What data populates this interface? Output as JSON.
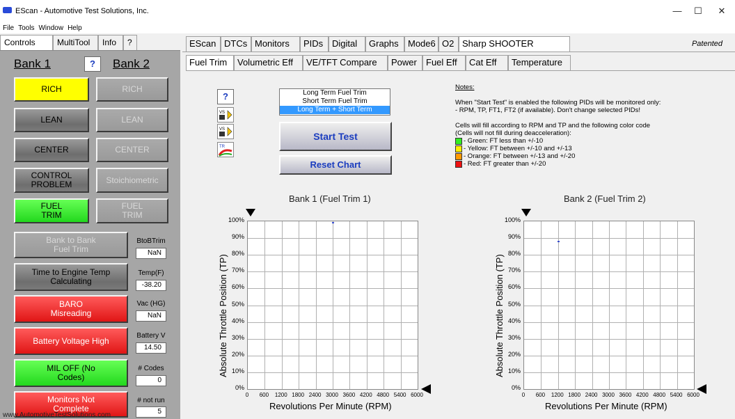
{
  "window": {
    "title": "EScan - Automotive Test Solutions, Inc.",
    "minimize": "—",
    "maximize": "☐",
    "close": "✕"
  },
  "menu": [
    "File",
    "Tools",
    "Window",
    "Help"
  ],
  "left_tabs": [
    "Controls",
    "MultiTool",
    "Info",
    "?"
  ],
  "left": {
    "bank1": "Bank 1",
    "q": "?",
    "bank2": "Bank 2",
    "rich1": "RICH",
    "rich2": "RICH",
    "lean1": "LEAN",
    "lean2": "LEAN",
    "center1": "CENTER",
    "center2": "CENTER",
    "control_problem": "CONTROL PROBLEM",
    "stoich": "Stoichiometric",
    "fuel_trim1": "FUEL TRIM",
    "fuel_trim2": "FUEL TRIM",
    "btb_btn": "Bank to Bank Fuel Trim",
    "btb_label": "BtoBTrim",
    "btb_value": "NaN",
    "temp_btn": "Time to Engine Temp Calculating",
    "temp_label": "Temp(F)",
    "temp_value": "-38.20",
    "baro_btn": "BARO Misreading",
    "vac_label": "Vac (HG)",
    "vac_value": "NaN",
    "batt_btn": "Battery Voltage High",
    "batt_label": "Battery V",
    "batt_value": "14.50",
    "mil_btn": "MIL OFF (No Codes)",
    "codes_label": "# Codes",
    "codes_value": "0",
    "monitors_btn": "Monitors Not Complete",
    "notrun_label": "# not run",
    "notrun_value": "5",
    "website": "www.AutomotiveTestSolutions.com"
  },
  "right_tabs": [
    "EScan",
    "DTCs",
    "Monitors",
    "PIDs",
    "Digital",
    "Graphs",
    "Mode6",
    "O2",
    "Sharp SHOOTER"
  ],
  "patented": "Patented",
  "sub_tabs": [
    "Fuel Trim",
    "Volumetric Eff",
    "VE/TFT Compare",
    "Power",
    "Fuel Eff",
    "Cat Eff",
    "Temperature"
  ],
  "content": {
    "help_q": "?",
    "icon_vs1": "VS",
    "icon_vs2": "VS",
    "icon_tr": "TR",
    "mode_options": [
      "Long Term Fuel Trim",
      "Short Term Fuel Trim",
      "Long Term + Short Term"
    ],
    "mode_selected": 2,
    "start_test": "Start Test",
    "reset_chart": "Reset Chart",
    "notes_title": "Notes:",
    "notes_line1": "When \"Start Test\" is enabled the following PIDs will be monitored only:",
    "notes_line2": "- RPM, TP, FT1, FT2 (if available).  Don't change selected PIDs!",
    "notes_line3": "Cells will fill according to RPM and TP and the following color code",
    "notes_line4": "(Cells will not fill during deacceleration):",
    "legend": [
      {
        "color": "#33ee22",
        "text": "- Green:  FT less than +/-10"
      },
      {
        "color": "#ffee00",
        "text": "- Yellow:  FT between +/-10 and +/-13"
      },
      {
        "color": "#ff9900",
        "text": "- Orange: FT between +/-13 and +/-20"
      },
      {
        "color": "#ee1111",
        "text": "- Red:     FT greater than +/-20"
      }
    ]
  },
  "chart_data": [
    {
      "type": "scatter",
      "title": "Bank 1 (Fuel Trim 1)",
      "xlabel": "Revolutions Per Minute (RPM)",
      "ylabel": "Absolute Throttle Position (TP)",
      "xlim": [
        0,
        6000
      ],
      "ylim": [
        0,
        100
      ],
      "x_ticks": [
        "0",
        "600",
        "1200",
        "1800",
        "2400",
        "3000",
        "3600",
        "4200",
        "4800",
        "5400",
        "6000"
      ],
      "y_ticks": [
        "0%",
        "10%",
        "20%",
        "30%",
        "40%",
        "50%",
        "60%",
        "70%",
        "80%",
        "90%",
        "100%"
      ],
      "grid": true,
      "points": [
        {
          "x": 3000,
          "y": 99
        }
      ]
    },
    {
      "type": "scatter",
      "title": "Bank 2 (Fuel Trim 2)",
      "xlabel": "Revolutions Per Minute (RPM)",
      "ylabel": "Absolute Throttle Position (TP)",
      "xlim": [
        0,
        6000
      ],
      "ylim": [
        0,
        100
      ],
      "x_ticks": [
        "0",
        "600",
        "1200",
        "1800",
        "2400",
        "3000",
        "3600",
        "4200",
        "4800",
        "5400",
        "6000"
      ],
      "y_ticks": [
        "0%",
        "10%",
        "20%",
        "30%",
        "40%",
        "50%",
        "60%",
        "70%",
        "80%",
        "90%",
        "100%"
      ],
      "grid": true,
      "points": [
        {
          "x": 1200,
          "y": 88
        }
      ]
    }
  ]
}
